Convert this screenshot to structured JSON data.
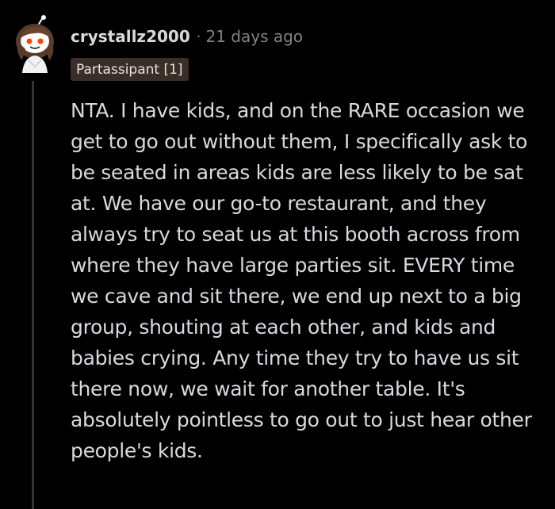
{
  "comment": {
    "author": "crystallz2000",
    "separator": "·",
    "time_ago": "21 days ago",
    "flair": "Partassipant [1]",
    "body": "NTA. I have kids, and on the RARE occasion we get to go out without them, I specifically ask to be seated in areas kids are less likely to be sat at. We have our go-to restaurant, and they always try to seat us at this booth across from where they have large parties sit. EVERY time we cave and sit there, we end up next to a big group, shouting at each other, and kids and babies crying. Any time they try to have us sit there now, we wait for another table. It's absolutely pointless to go out to just hear other people's kids."
  },
  "colors": {
    "background": "#000000",
    "text": "#d7dadc",
    "meta": "#818384",
    "flair_bg": "#3a2f28",
    "thread_line": "#343536"
  },
  "icons": {
    "avatar": "snoo-avatar-icon"
  }
}
